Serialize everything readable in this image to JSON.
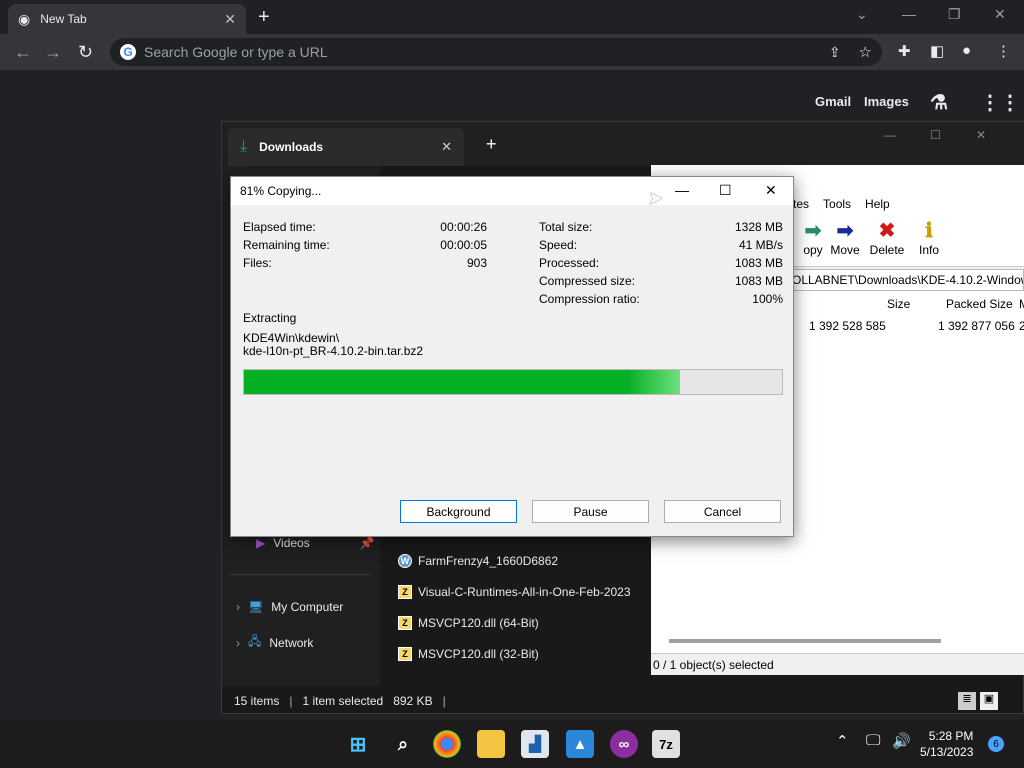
{
  "chrome": {
    "tab_title": "New Tab",
    "omnibox_placeholder": "Search Google or type a URL",
    "ntp_gmail": "Gmail",
    "ntp_images": "Images"
  },
  "explorer": {
    "tab_title": "Downloads",
    "sidebar": [
      {
        "label": "Videos"
      },
      {
        "label": "My Computer"
      },
      {
        "label": "Network"
      }
    ],
    "files": [
      {
        "name": "FarmFrenzy4_1660D6862"
      },
      {
        "name": "Visual-C-Runtimes-All-in-One-Feb-2023"
      },
      {
        "name": "MSVCP120.dll (64-Bit)"
      },
      {
        "name": "MSVCP120.dll (32-Bit)"
      }
    ],
    "status": {
      "items": "15 items",
      "selected": "1 item selected",
      "size": "892 KB"
    }
  },
  "zip": {
    "menu": [
      "tes",
      "Tools",
      "Help"
    ],
    "toolbar": {
      "copy": "opy",
      "move": "Move",
      "delete": "Delete",
      "info": "Info"
    },
    "path": "OLLABNET\\Downloads\\KDE-4.10.2-Windows",
    "headers": {
      "size": "Size",
      "packed": "Packed Size",
      "extra": "M"
    },
    "row": {
      "size": "1 392 528 585",
      "packed": "1 392 877 056",
      "extra": "2"
    },
    "status": "0 / 1 object(s) selected"
  },
  "dialog": {
    "title": "81% Copying...",
    "left": [
      {
        "label": "Elapsed time:",
        "value": "00:00:26"
      },
      {
        "label": "Remaining time:",
        "value": "00:00:05"
      },
      {
        "label": "Files:",
        "value": "903"
      }
    ],
    "right": [
      {
        "label": "Total size:",
        "value": "1328 MB"
      },
      {
        "label": "Speed:",
        "value": "41 MB/s"
      },
      {
        "label": "Processed:",
        "value": "1083 MB"
      },
      {
        "label": "Compressed size:",
        "value": "1083 MB"
      },
      {
        "label": "Compression ratio:",
        "value": "100%"
      }
    ],
    "operation": "Extracting",
    "path_line1": "KDE4Win\\kdewin\\",
    "path_line2": "kde-l10n-pt_BR-4.10.2-bin.tar.bz2",
    "progress": 0.81,
    "buttons": {
      "background": "Background",
      "pause": "Pause",
      "cancel": "Cancel"
    }
  },
  "taskbar": {
    "time": "5:28 PM",
    "date": "5/13/2023",
    "notifications": "6",
    "zip_label": "7z"
  }
}
